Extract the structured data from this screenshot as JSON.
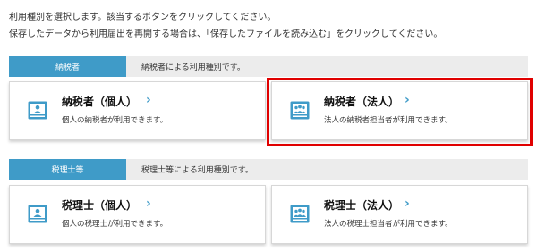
{
  "intro": {
    "line1": "利用種別を選択します。該当するボタンをクリックしてください。",
    "line2": "保存したデータから利用届出を再開する場合は、「保存したファイルを読み込む」をクリックしてください。"
  },
  "sections": [
    {
      "tag": "納税者",
      "desc": "納税者による利用種別です。",
      "cards": [
        {
          "title": "納税者（個人）",
          "sub": "個人の納税者が利用できます。",
          "icon": "person-id-icon"
        },
        {
          "title": "納税者（法人）",
          "sub": "法人の納税者担当者が利用できます。",
          "icon": "group-id-icon"
        }
      ]
    },
    {
      "tag": "税理士等",
      "desc": "税理士等による利用種別です。",
      "cards": [
        {
          "title": "税理士（個人）",
          "sub": "個人の税理士が利用できます。",
          "icon": "person-id-icon"
        },
        {
          "title": "税理士（法人）",
          "sub": "法人の税理士担当者が利用できます。",
          "icon": "group-id-icon"
        }
      ]
    }
  ],
  "colors": {
    "accent": "#3f9bc8",
    "highlight": "#e00000",
    "header_bg": "#ececec"
  }
}
